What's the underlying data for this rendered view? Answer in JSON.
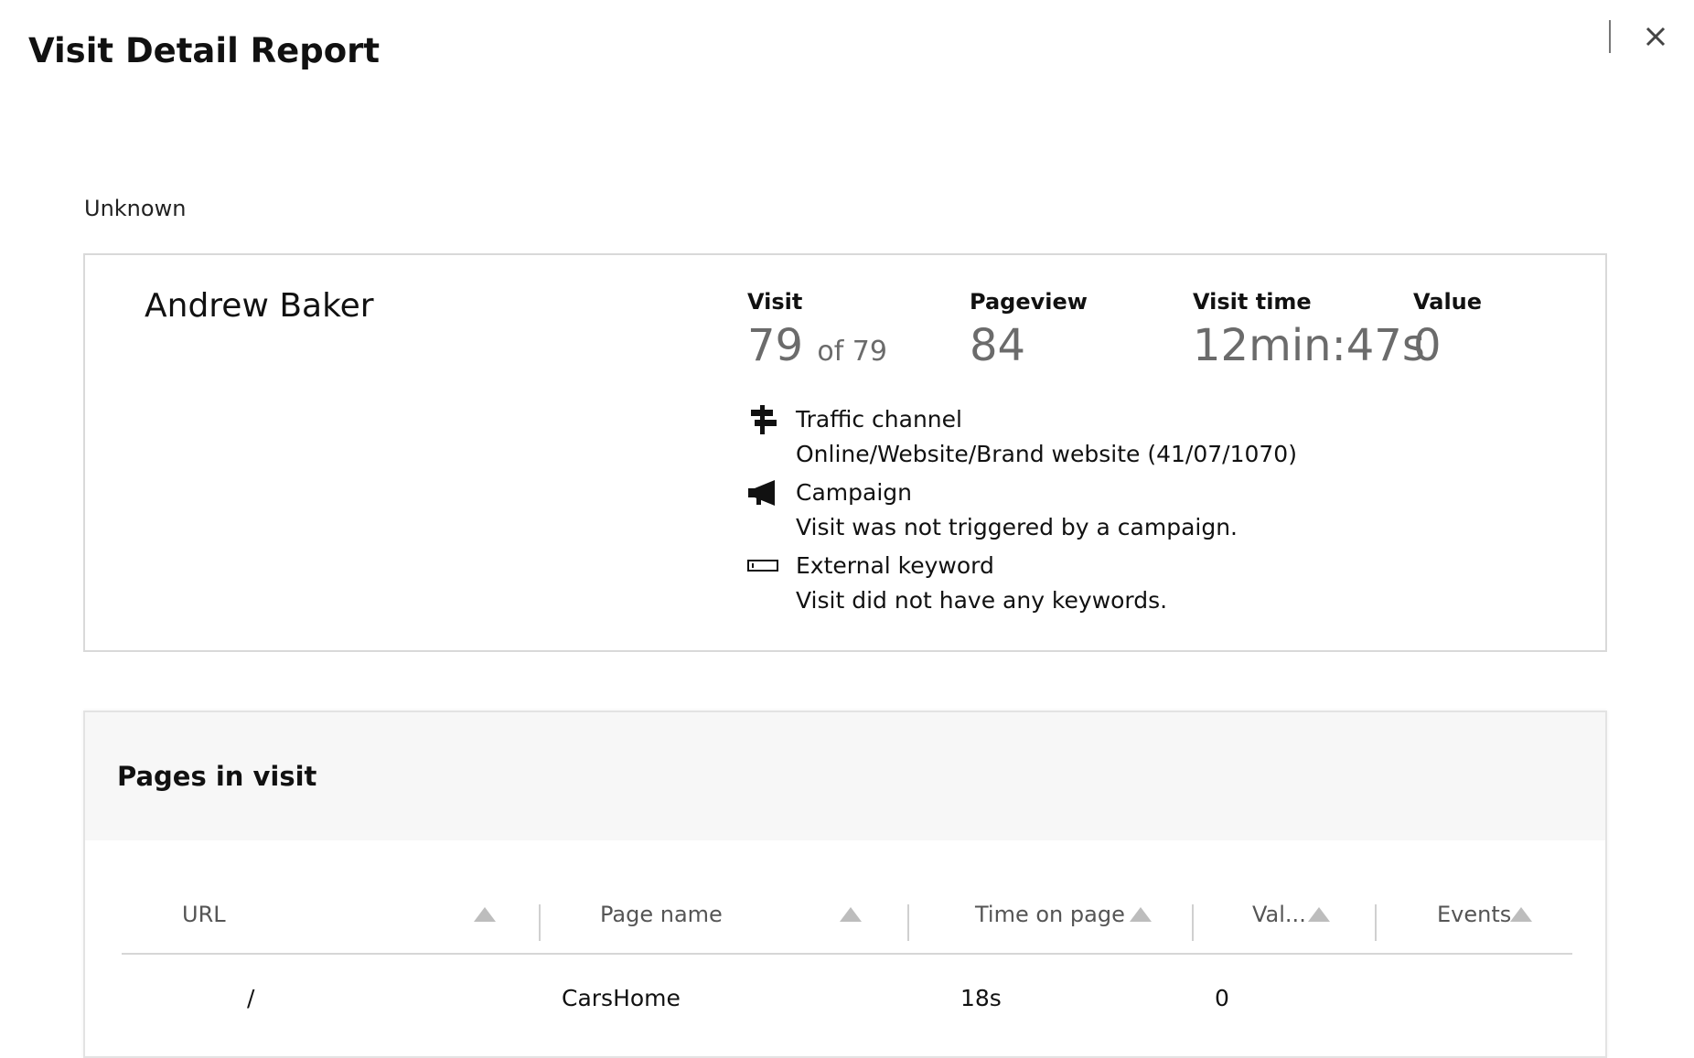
{
  "header": {
    "title": "Visit Detail Report"
  },
  "contact": {
    "status": "Unknown",
    "name": "Andrew Baker"
  },
  "stats": {
    "visit": {
      "label": "Visit",
      "value": "79",
      "of_text": "of 79"
    },
    "pageview": {
      "label": "Pageview",
      "value": "84"
    },
    "visit_time": {
      "label": "Visit time",
      "value": "12min:47s"
    },
    "value": {
      "label": "Value",
      "value": "0"
    }
  },
  "details": {
    "traffic_channel": {
      "icon": "signpost-icon",
      "label": "Traffic channel",
      "value": "Online/Website/Brand website (41/07/1070)"
    },
    "campaign": {
      "icon": "megaphone-icon",
      "label": "Campaign",
      "value": "Visit was not triggered by a campaign."
    },
    "external_keyword": {
      "icon": "keyword-input-icon",
      "label": "External keyword",
      "value": "Visit did not have any keywords."
    }
  },
  "pages": {
    "title": "Pages in visit",
    "columns": [
      "URL",
      "Page name",
      "Time on page",
      "Val...",
      "Events"
    ],
    "rows": [
      {
        "url": "/",
        "page_name": "CarsHome",
        "time_on_page": "18s",
        "value": "0",
        "events": ""
      }
    ]
  },
  "colors": {
    "stat_value": "#6b6b6b",
    "border": "#d9d9d9",
    "panel_header_bg": "#f7f7f7",
    "sort_arrow": "#bdbdbd"
  }
}
